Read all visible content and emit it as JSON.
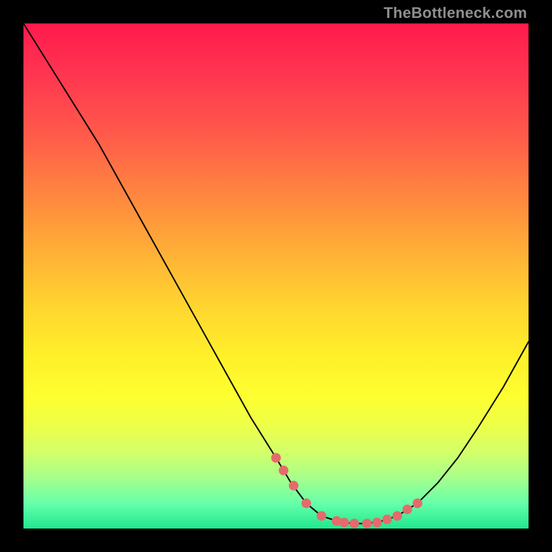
{
  "watermark": "TheBottleneck.com",
  "chart_data": {
    "type": "line",
    "title": "",
    "xlabel": "",
    "ylabel": "",
    "xlim": [
      0,
      100
    ],
    "ylim": [
      0,
      100
    ],
    "grid": false,
    "series": [
      {
        "name": "curve",
        "x": [
          0,
          5,
          10,
          15,
          20,
          25,
          30,
          35,
          40,
          45,
          50,
          53,
          56,
          59,
          62,
          65,
          68,
          71,
          74,
          78,
          82,
          86,
          90,
          95,
          100
        ],
        "y": [
          100,
          92,
          84,
          76,
          67,
          58,
          49,
          40,
          31,
          22,
          14,
          9,
          5,
          2.5,
          1.5,
          1,
          1,
          1.5,
          2.5,
          5,
          9,
          14,
          20,
          28,
          37
        ]
      }
    ],
    "markers": {
      "name": "dots",
      "color": "#e46b6b",
      "radius_px": 7,
      "x": [
        50,
        51.5,
        53.5,
        56,
        59,
        62,
        63.5,
        65.5,
        68,
        70,
        72,
        74,
        76,
        78
      ],
      "y": [
        14,
        11.5,
        8.5,
        5,
        2.5,
        1.5,
        1.2,
        1.0,
        1.0,
        1.2,
        1.8,
        2.5,
        3.8,
        5
      ]
    },
    "gradient_stops": [
      {
        "pos": 0.0,
        "color": "#ff1a4d"
      },
      {
        "pos": 0.1,
        "color": "#ff3550"
      },
      {
        "pos": 0.22,
        "color": "#ff5a4a"
      },
      {
        "pos": 0.35,
        "color": "#ff8a3e"
      },
      {
        "pos": 0.46,
        "color": "#ffb236"
      },
      {
        "pos": 0.56,
        "color": "#ffd52f"
      },
      {
        "pos": 0.66,
        "color": "#fff02a"
      },
      {
        "pos": 0.74,
        "color": "#fdff30"
      },
      {
        "pos": 0.8,
        "color": "#ecff4a"
      },
      {
        "pos": 0.85,
        "color": "#d2ff6a"
      },
      {
        "pos": 0.9,
        "color": "#a6ff8c"
      },
      {
        "pos": 0.95,
        "color": "#66ffaa"
      },
      {
        "pos": 1.0,
        "color": "#20e88f"
      }
    ]
  }
}
